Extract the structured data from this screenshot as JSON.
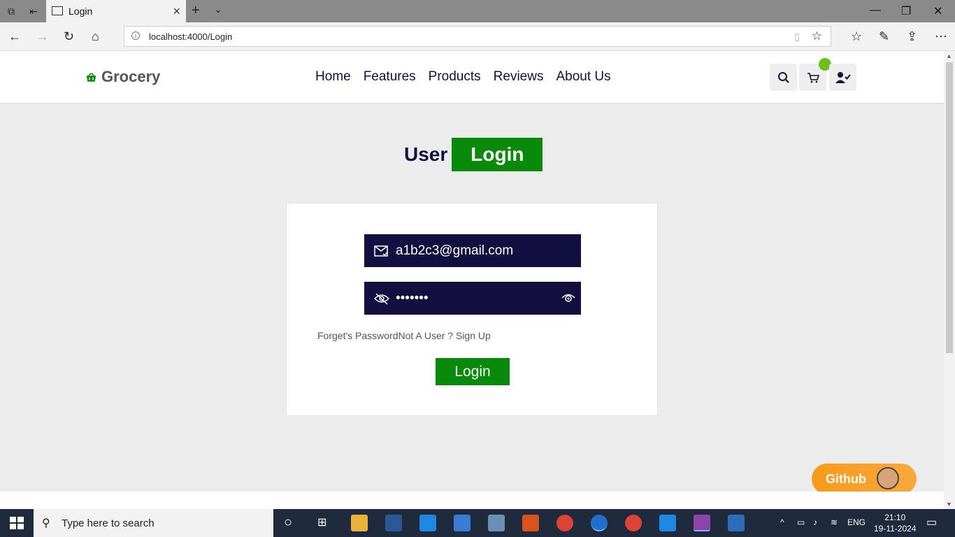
{
  "browser": {
    "tab_title": "Login",
    "url": "localhost:4000/Login"
  },
  "site": {
    "brand": "Grocery",
    "nav": [
      "Home",
      "Features",
      "Products",
      "Reviews",
      "About Us"
    ]
  },
  "login": {
    "heading_user": "User",
    "heading_login": "Login",
    "email_value": "a1b2c3@gmail.com",
    "password_mask": "•••••••",
    "forgot_link": "Forget's Password",
    "signup_link": "Not A User ? Sign Up",
    "submit_label": "Login"
  },
  "github_button": "Github",
  "taskbar": {
    "search_placeholder": "Type here to search",
    "language": "ENG",
    "time": "21:10",
    "date": "19-11-2024"
  },
  "colors": {
    "primary_dark": "#130f40",
    "accent_green": "#0a8a0a",
    "github_orange": "#f79a1b"
  }
}
